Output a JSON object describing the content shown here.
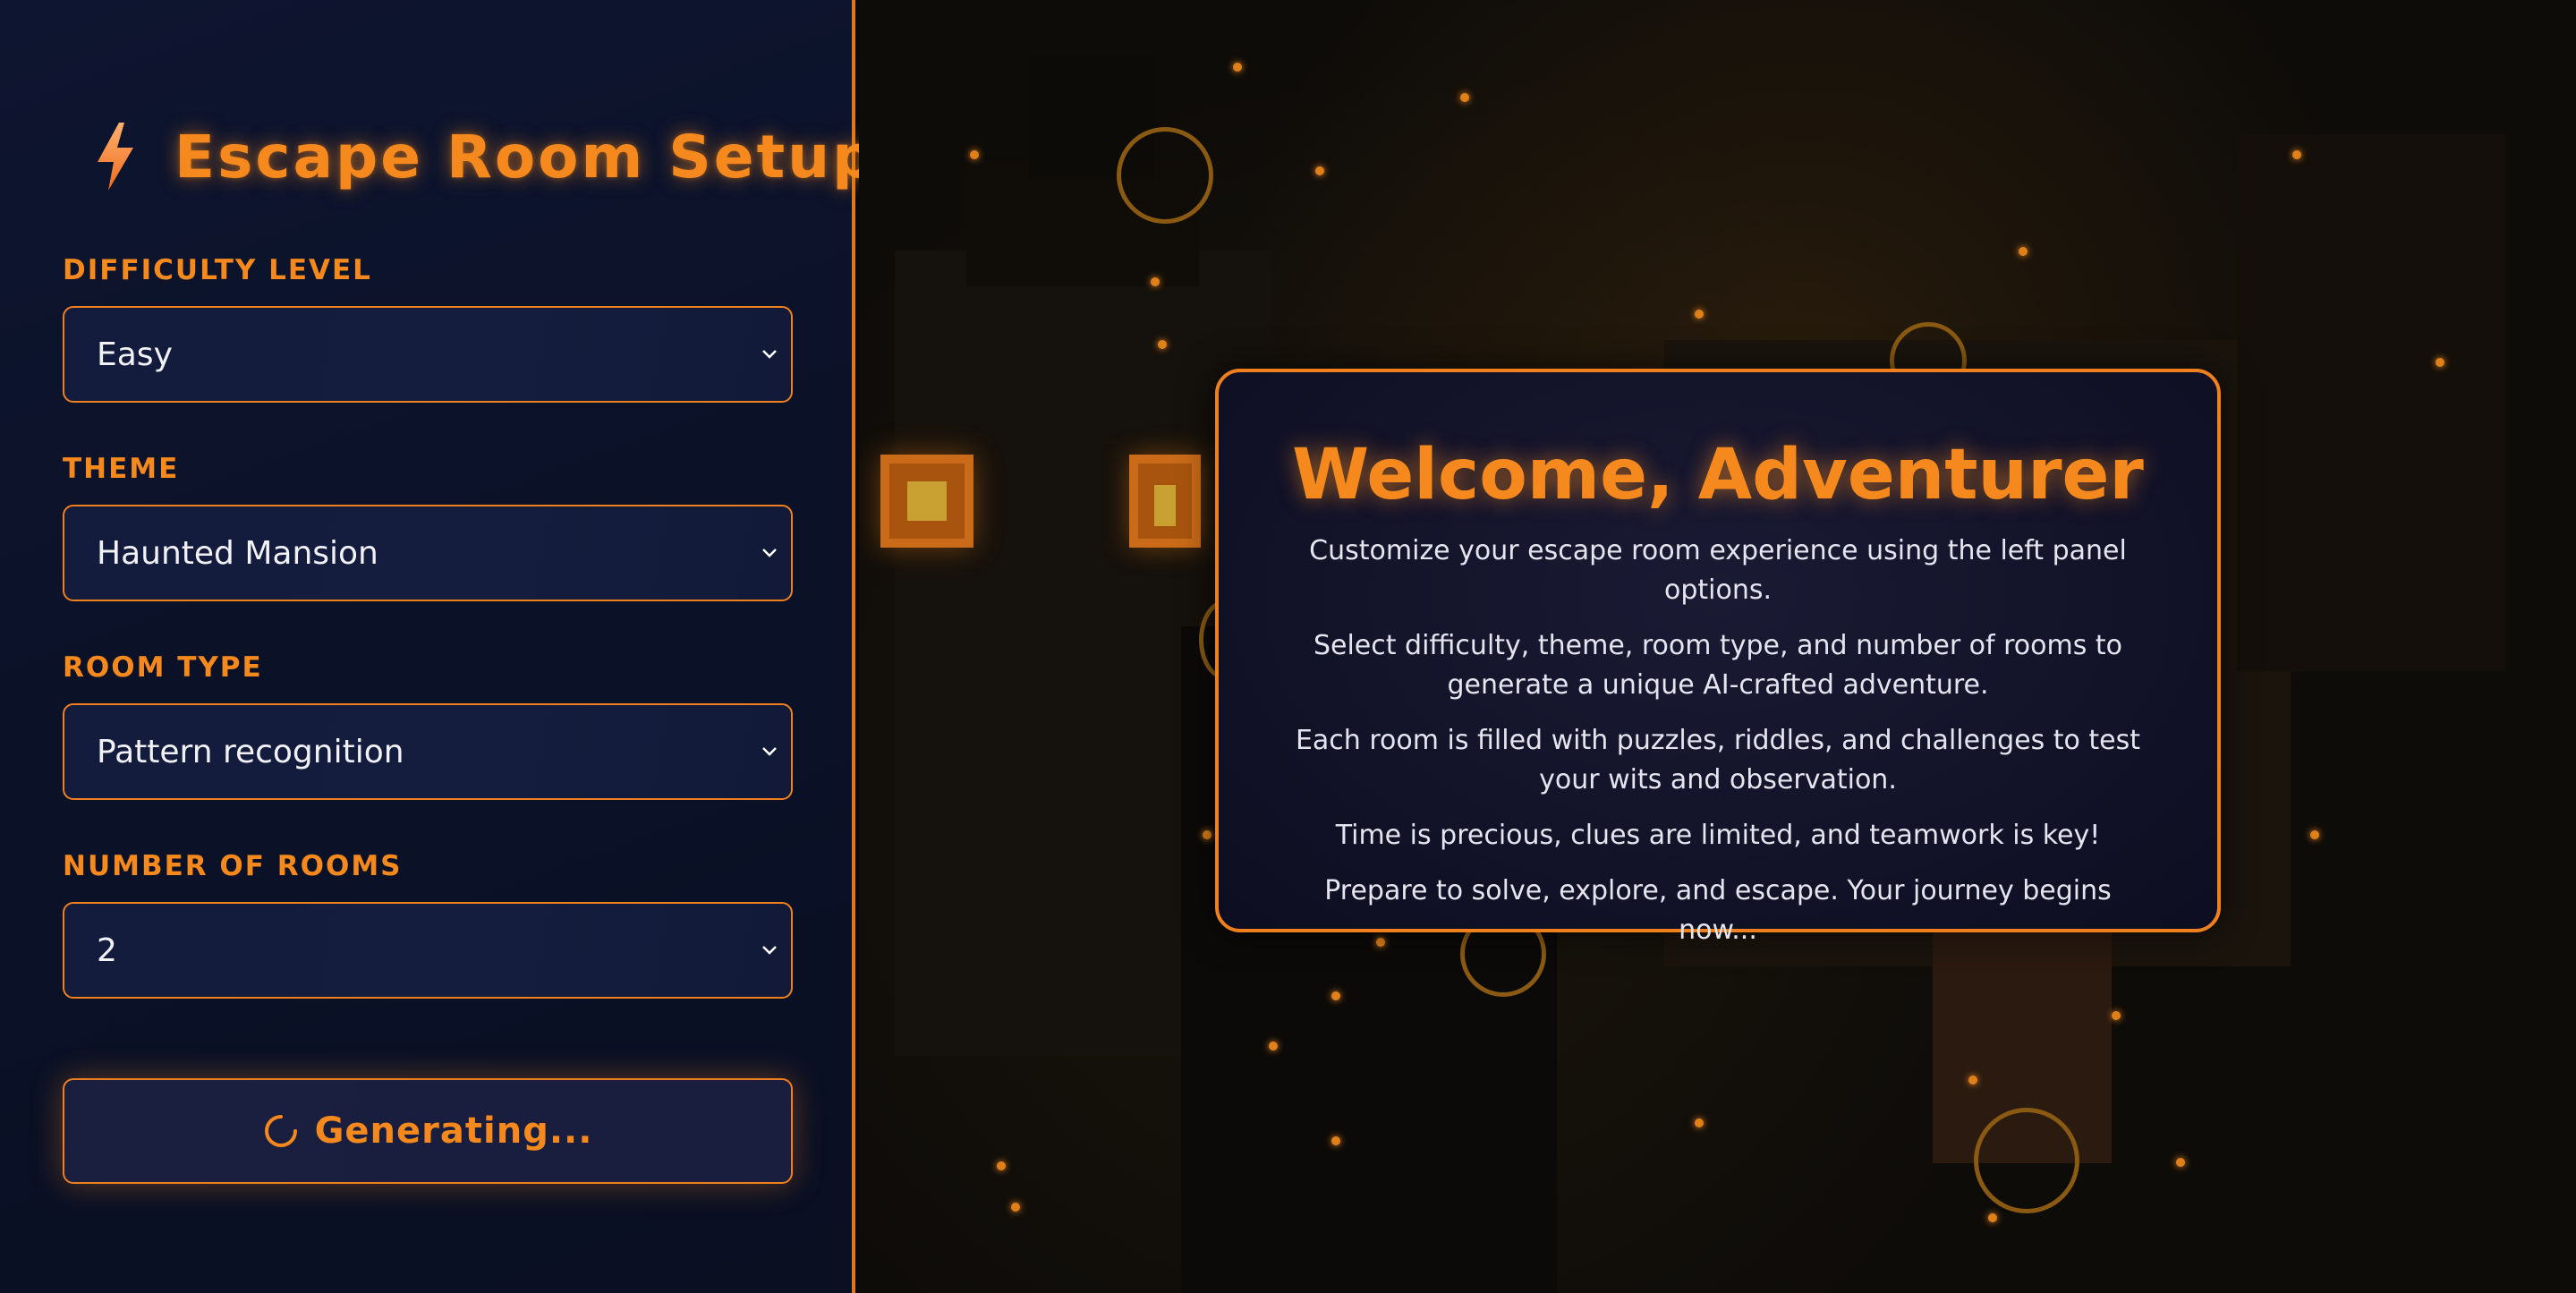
{
  "panel": {
    "title": "Escape Room Setup",
    "title_icon": "lightning-bolt-icon",
    "fields": {
      "difficulty": {
        "label": "DIFFICULTY LEVEL",
        "value": "Easy"
      },
      "theme": {
        "label": "THEME",
        "value": "Haunted Mansion"
      },
      "room_type": {
        "label": "ROOM TYPE",
        "value": "Pattern recognition"
      },
      "rooms": {
        "label": "NUMBER OF ROOMS",
        "value": "2"
      }
    },
    "generate_button": {
      "label": "Generating...",
      "icon": "spinner-icon"
    }
  },
  "welcome": {
    "title": "Welcome, Adventurer",
    "paragraphs": [
      "Customize your escape room experience using the left panel options.",
      "Select difficulty, theme, room type, and number of rooms to generate a unique AI-crafted adventure.",
      "Each room is filled with puzzles, riddles, and challenges to test your wits and observation.",
      "Time is precious, clues are limited, and teamwork is key!",
      "Prepare to solve, explore, and escape. Your journey begins now..."
    ]
  },
  "colors": {
    "accent": "#f5891d",
    "panel_bg": "#0e1530",
    "border": "#f0801e",
    "card_bg": "#121228"
  }
}
